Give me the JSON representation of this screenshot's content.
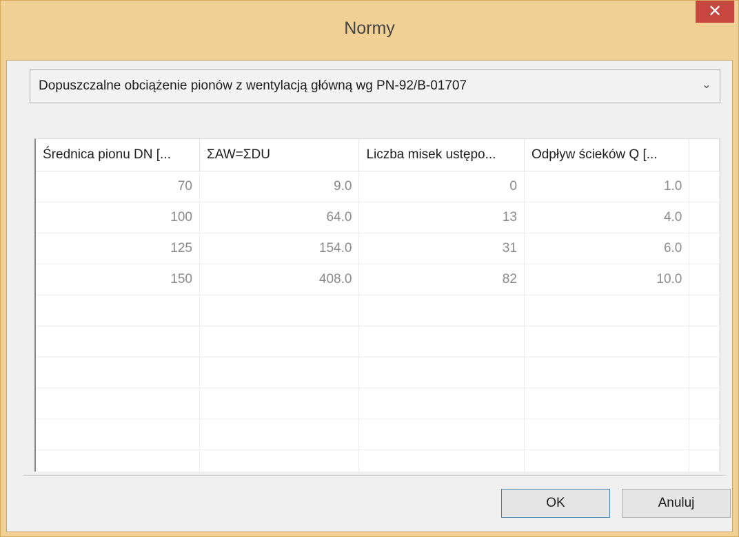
{
  "window": {
    "title": "Normy",
    "close_label": "✕"
  },
  "norm_select": {
    "value": "Dopuszczalne obciążenie pionów z wentylacją główną wg PN-92/B-01707",
    "arrow": "⌄"
  },
  "table": {
    "columns": [
      "Średnica pionu DN [...",
      "ΣAW=ΣDU",
      "Liczba misek ustępo...",
      "Odpływ ścieków Q [..."
    ],
    "rows": [
      [
        "70",
        "9.0",
        "0",
        "1.0"
      ],
      [
        "100",
        "64.0",
        "13",
        "4.0"
      ],
      [
        "125",
        "154.0",
        "31",
        "6.0"
      ],
      [
        "150",
        "408.0",
        "82",
        "10.0"
      ]
    ],
    "empty_rows": 6
  },
  "buttons": {
    "ok": "OK",
    "cancel": "Anuluj"
  },
  "colors": {
    "title_bar": "#f0d095",
    "close": "#c7463e",
    "ok_border": "#3c7fb1"
  }
}
